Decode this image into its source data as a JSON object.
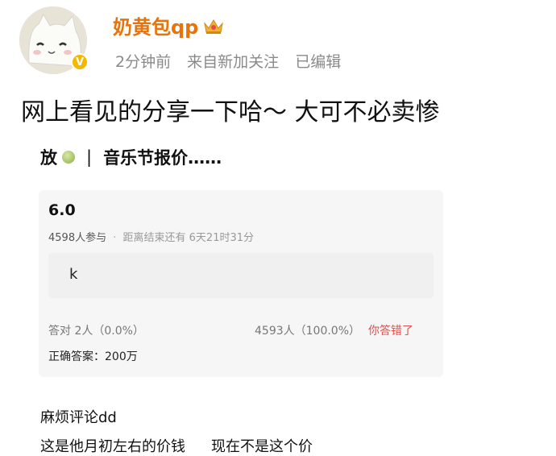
{
  "post": {
    "username": "奶黄包qp",
    "time": "2分钟前",
    "source": "来自新加关注",
    "edited": "已编辑",
    "text": "网上看见的分享一下哈～ 大可不必卖惨",
    "icons": {
      "avatar": "cat-avatar",
      "verified": "verified-badge-icon",
      "crown": "crown-icon"
    },
    "colors": {
      "username": "#e8730a",
      "verified": "#f5b800",
      "wrong": "#d9534f"
    }
  },
  "screenshot": {
    "title_left": "放",
    "title_bar": "|",
    "title_right": "音乐节报价……",
    "quiz": {
      "question_num": "6.0",
      "participants": "4598人参与",
      "separator": "·",
      "remaining": "距离结束还有 6天21时31分",
      "option": "k",
      "correct_stats": "答对 2人（0.0%）",
      "wrong_stats": "4593人（100.0%）",
      "wrong_label": "你答错了",
      "answer": "正确答案：200万"
    },
    "comment_1": "麻烦评论dd",
    "comment_2a": "这是他月初左右的价钱",
    "comment_2b": "现在不是这个价"
  }
}
